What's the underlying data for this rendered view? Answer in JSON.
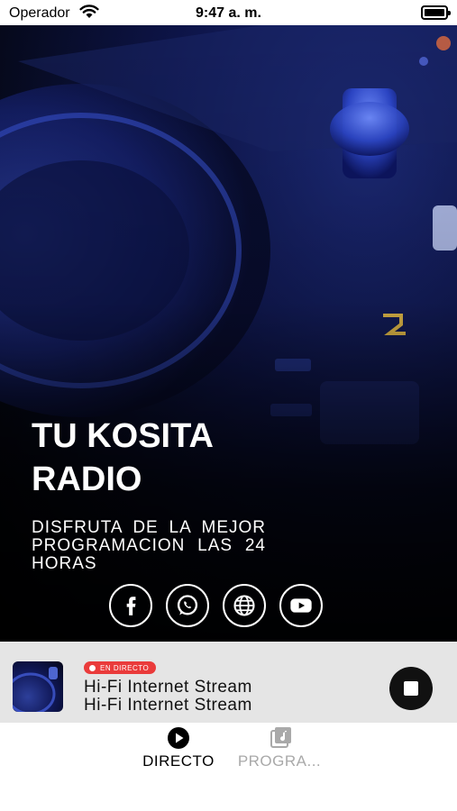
{
  "status_bar": {
    "carrier": "Operador",
    "time": "9:47 a. m.",
    "icons": [
      "wifi-icon",
      "battery-icon"
    ]
  },
  "hero": {
    "title": "TU KOSITA RADIO",
    "description": "DISFRUTA DE LA MEJOR PROGRAMACION LAS 24 HORAS",
    "socials": [
      {
        "name": "facebook",
        "icon": "facebook-icon"
      },
      {
        "name": "whatsapp",
        "icon": "whatsapp-icon"
      },
      {
        "name": "website",
        "icon": "globe-icon"
      },
      {
        "name": "youtube",
        "icon": "youtube-icon"
      }
    ]
  },
  "player": {
    "live_label": "EN DIRECTO",
    "track_title": "Hi-Fi Internet Stream",
    "track_subtitle": "Hi-Fi Internet Stream",
    "control_icon": "stop-icon"
  },
  "tabs": [
    {
      "label": "DIRECTO",
      "icon": "play-circle-icon",
      "active": true
    },
    {
      "label": "PROGRA...",
      "icon": "music-note-icon",
      "active": false
    }
  ],
  "colors": {
    "live_badge": "#ea3b3b",
    "player_bg": "#e5e5e5",
    "hero_accent": "#1c2a78",
    "tab_inactive": "#a9a9a9"
  }
}
